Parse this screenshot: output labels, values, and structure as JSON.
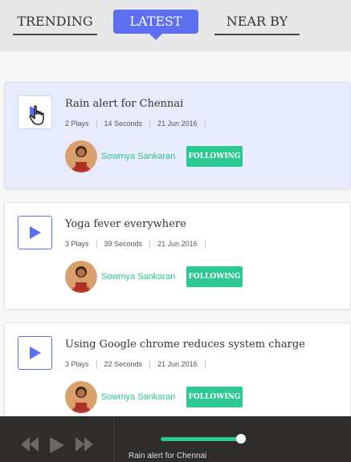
{
  "tabs": {
    "trending": "TRENDING",
    "latest": "LATEST",
    "nearby": "NEAR BY",
    "active": "latest"
  },
  "feed": [
    {
      "title": "Rain alert for Chennai",
      "plays": "2 Plays",
      "duration": "14 Seconds",
      "date": "21 Jun 2016",
      "author": "Sowmya Sankaran",
      "follow_label": "FOLLOWING",
      "active": true
    },
    {
      "title": "Yoga fever everywhere",
      "plays": "3 Plays",
      "duration": "39 Seconds",
      "date": "21 Jun 2016",
      "author": "Sowmya Sankaran",
      "follow_label": "FOLLOWING",
      "active": false
    },
    {
      "title": "Using Google chrome reduces system charge",
      "plays": "3 Plays",
      "duration": "22 Seconds",
      "date": "21 Jun 2016",
      "author": "Sowmya Sankaran",
      "follow_label": "FOLLOWING",
      "active": false
    }
  ],
  "player": {
    "now_playing": "Rain alert for Chennai",
    "progress_fraction": 1.0
  },
  "colors": {
    "accent": "#5b6ff0",
    "green": "#2ec893",
    "player_bg": "#2f2d2c",
    "active_card_bg": "#e8ebfb"
  },
  "icons": [
    "play-icon",
    "hand-cursor-icon",
    "rewind-icon",
    "forward-icon"
  ]
}
